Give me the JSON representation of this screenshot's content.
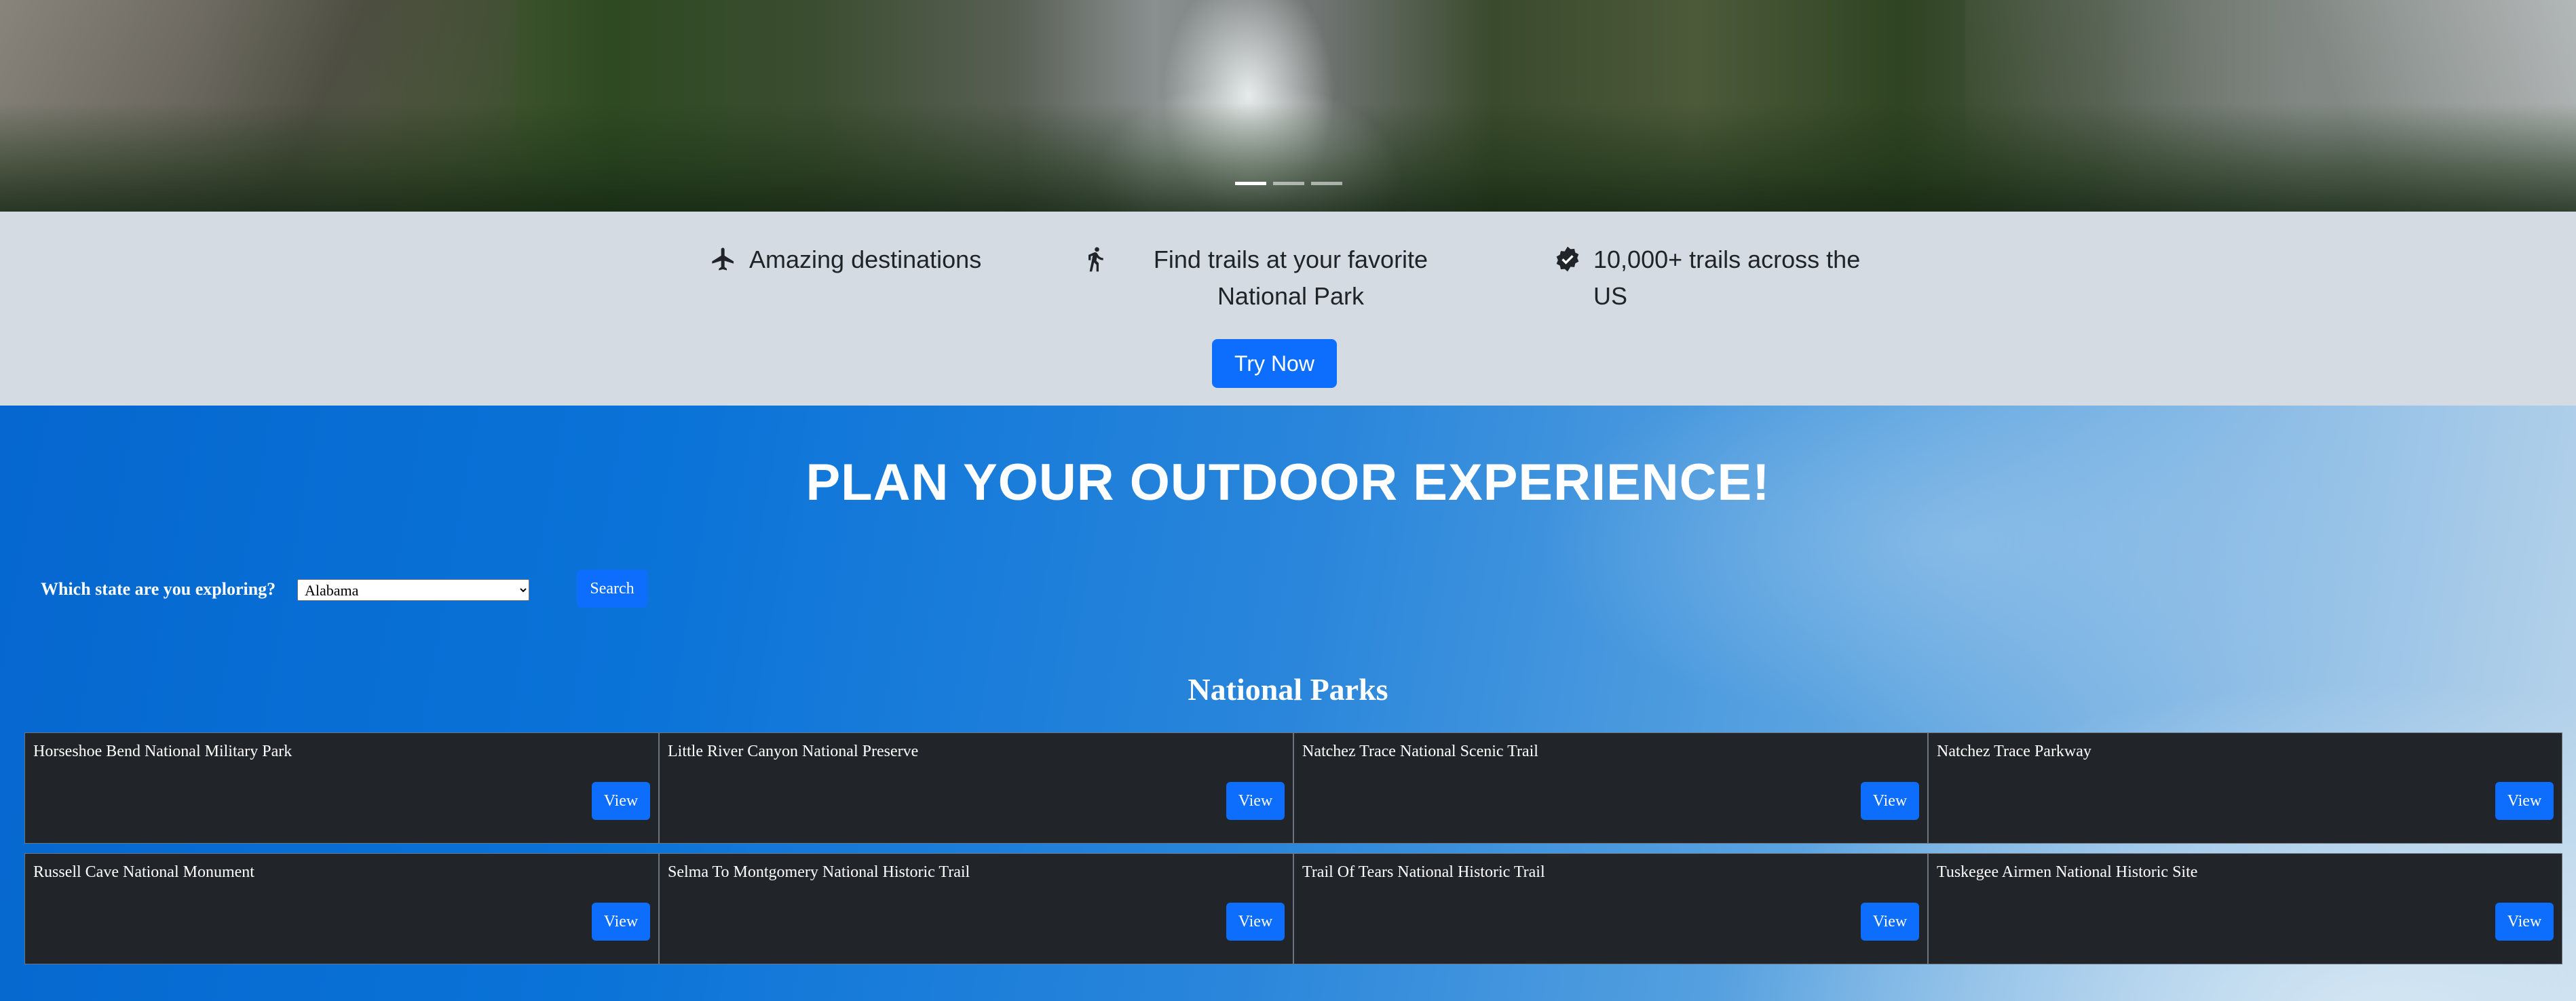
{
  "hero": {
    "slides": 3,
    "active_slide": 1
  },
  "features": {
    "items": [
      {
        "icon": "airplane-icon",
        "text": "Amazing destinations"
      },
      {
        "icon": "person-walking-icon",
        "text": "Find trails at your favorite National Park"
      },
      {
        "icon": "check-badge-icon",
        "text": "10,000+ trails across the US"
      }
    ],
    "cta_label": "Try Now"
  },
  "plan": {
    "title": "PLAN YOUR OUTDOOR EXPERIENCE!",
    "state_label": "Which state are you exploring?",
    "state_selected": "Alabama",
    "search_label": "Search",
    "parks_heading": "National Parks",
    "view_label": "View",
    "parks": [
      "Horseshoe Bend National Military Park",
      "Little River Canyon National Preserve",
      "Natchez Trace National Scenic Trail",
      "Natchez Trace Parkway",
      "Russell Cave National Monument",
      "Selma To Montgomery National Historic Trail",
      "Trail Of Tears National Historic Trail",
      "Tuskegee Airmen National Historic Site"
    ]
  },
  "colors": {
    "primary": "#0d6efd",
    "card_bg": "#212529",
    "strip_bg": "#d5dbe2"
  }
}
